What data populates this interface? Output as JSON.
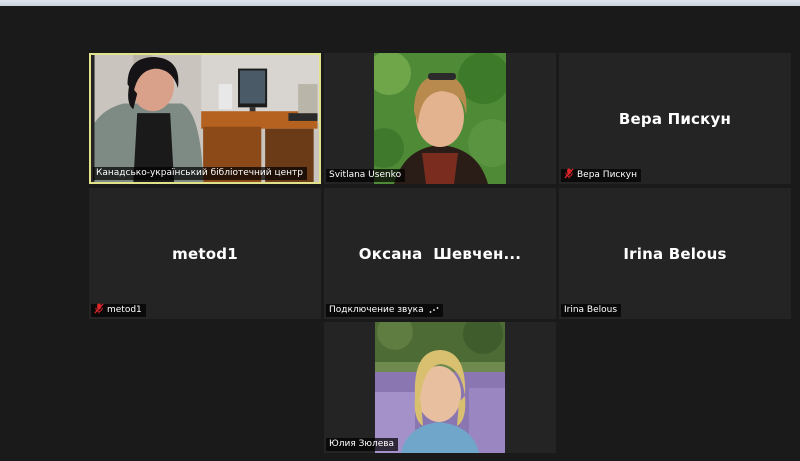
{
  "participants": [
    {
      "name": "Канадсько-український бібліотечний центр",
      "video": true,
      "muted": false,
      "active_speaker": true
    },
    {
      "name": "Svitlana Usenko",
      "video": true,
      "muted": false
    },
    {
      "name": "Вера Пискун",
      "display_name": "Вера Пискун",
      "video": false,
      "muted": true
    },
    {
      "name": "metod1",
      "display_name": "metod1",
      "video": false,
      "muted": true
    },
    {
      "name": "Подключение звука",
      "display_name": "Оксана  Шевчен...",
      "video": false,
      "muted": false,
      "status_icon": "connecting-dots-icon"
    },
    {
      "name": "Irina Belous",
      "display_name": "Irina Belous",
      "video": false,
      "muted": false
    },
    {
      "name": "Юлия Зюлева",
      "video": true,
      "muted": false
    }
  ],
  "colors": {
    "background": "#1a1a1a",
    "tile": "#242424",
    "active_border": "#e2e28a",
    "muted_icon": "#e0262b"
  }
}
